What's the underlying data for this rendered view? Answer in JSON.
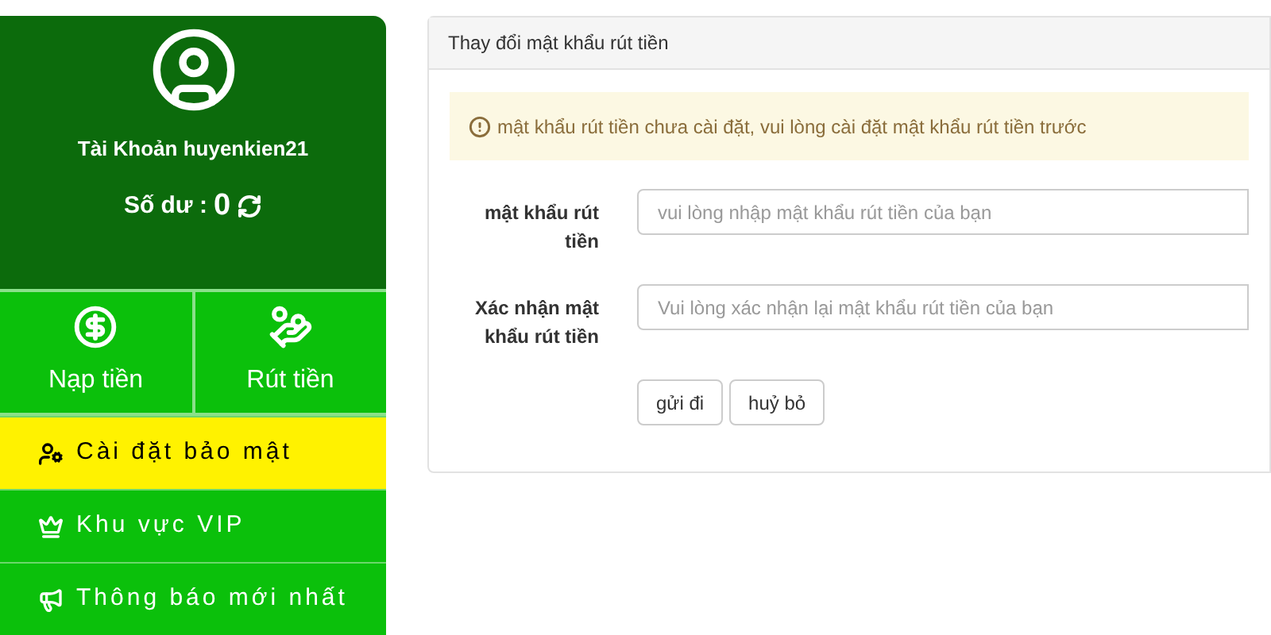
{
  "account": {
    "name": "Tài Khoản huyenkien21",
    "balance_label": "Số dư :",
    "balance": "0"
  },
  "actions": [
    {
      "label": "Nạp tiền",
      "kind": "deposit"
    },
    {
      "label": "Rút tiền",
      "kind": "withdraw"
    }
  ],
  "menu": [
    {
      "label": "Cài đặt bảo mật",
      "kind": "security",
      "selected": true
    },
    {
      "label": "Khu vực VIP",
      "kind": "vip",
      "selected": false
    },
    {
      "label": "Thông báo mới nhất",
      "kind": "news",
      "selected": false
    }
  ],
  "panel": {
    "title": "Thay đổi mật khẩu rút tiền",
    "alert": "mật khẩu rút tiền chưa cài đặt, vui lòng cài đặt mật khẩu rút tiền trước",
    "fields": [
      {
        "label": "mật khẩu rút tiền",
        "placeholder": "vui lòng nhập mật khẩu rút tiền của bạn"
      },
      {
        "label": "Xác nhận mật khẩu rút tiền",
        "placeholder": "Vui lòng xác nhận lại mật khẩu rút tiền của bạn"
      }
    ],
    "buttons": [
      "gửi đi",
      "huỷ bỏ"
    ]
  }
}
